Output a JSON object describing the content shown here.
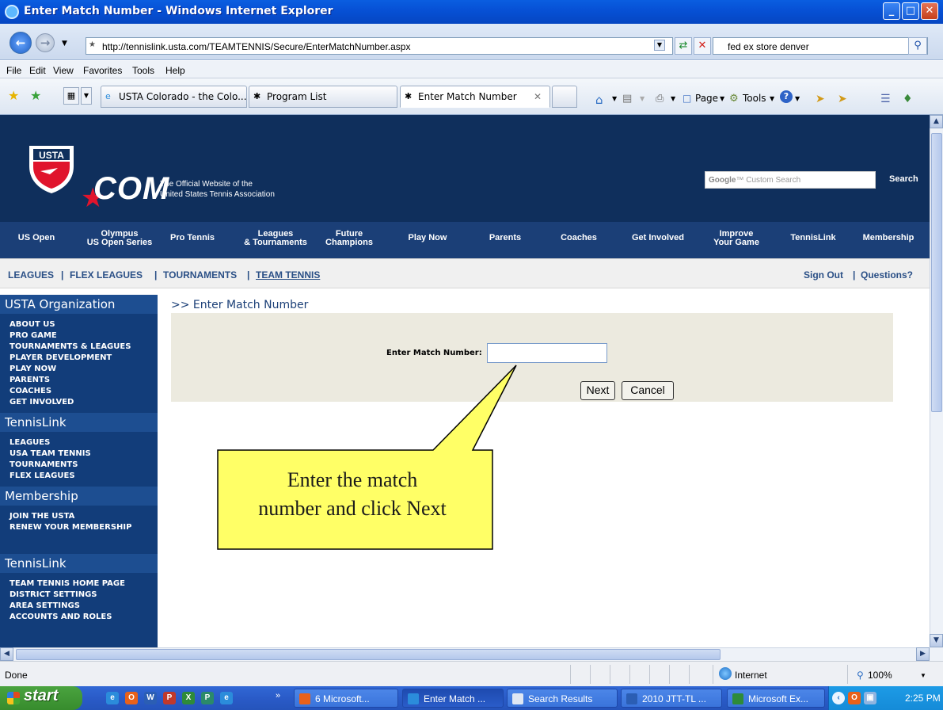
{
  "window": {
    "title": "Enter Match Number - Windows Internet Explorer"
  },
  "address": {
    "url": "http://tennislink.usta.com/TEAMTENNIS/Secure/EnterMatchNumber.aspx",
    "search_text": "fed ex store denver"
  },
  "menu": [
    "File",
    "Edit",
    "View",
    "Favorites",
    "Tools",
    "Help"
  ],
  "tabs": [
    {
      "label": "USTA Colorado - the Colo..."
    },
    {
      "label": "Program List"
    },
    {
      "label": "Enter Match Number"
    }
  ],
  "toolbar": {
    "page_label": "Page",
    "tools_label": "Tools"
  },
  "site": {
    "logo_text": "USTA",
    "com_text": "COM",
    "tagline_1": "The Official Website of the",
    "tagline_2": "United States Tennis Association",
    "search_google": "Google",
    "search_placeholder": "Custom Search",
    "search_button": "Search"
  },
  "nav": [
    {
      "l1": "US Open",
      "l2": ""
    },
    {
      "l1": "Olympus",
      "l2": "US Open Series"
    },
    {
      "l1": "Pro Tennis",
      "l2": ""
    },
    {
      "l1": "Leagues",
      "l2": "& Tournaments"
    },
    {
      "l1": "Future",
      "l2": "Champions"
    },
    {
      "l1": "Play Now",
      "l2": ""
    },
    {
      "l1": "Parents",
      "l2": ""
    },
    {
      "l1": "Coaches",
      "l2": ""
    },
    {
      "l1": "Get Involved",
      "l2": ""
    },
    {
      "l1": "Improve",
      "l2": "Your Game"
    },
    {
      "l1": "TennisLink",
      "l2": ""
    },
    {
      "l1": "Membership",
      "l2": ""
    }
  ],
  "subnav": {
    "leagues": "LEAGUES",
    "sep": "|",
    "flex": "FLEX LEAGUES",
    "tournaments": "TOURNAMENTS",
    "team_tennis": "TEAM TENNIS",
    "sign_out": "Sign Out",
    "questions": "Questions?"
  },
  "sidebar": {
    "sections": [
      {
        "title": "USTA Organization",
        "items": [
          "ABOUT US",
          "PRO GAME",
          "TOURNAMENTS & LEAGUES",
          "PLAYER DEVELOPMENT",
          "PLAY NOW",
          "PARENTS",
          "COACHES",
          "GET INVOLVED"
        ]
      },
      {
        "title": "TennisLink",
        "items": [
          "LEAGUES",
          "USA TEAM TENNIS",
          "TOURNAMENTS",
          "FLEX LEAGUES"
        ]
      },
      {
        "title": "Membership",
        "items": [
          "JOIN THE USTA",
          "RENEW YOUR MEMBERSHIP"
        ]
      },
      {
        "title": "TennisLink",
        "items": [
          "TEAM TENNIS HOME PAGE",
          "DISTRICT SETTINGS",
          "AREA SETTINGS",
          "ACCOUNTS AND ROLES"
        ]
      }
    ]
  },
  "content": {
    "page_title": ">> Enter Match Number",
    "match_label": "Enter Match Number:",
    "match_value": "",
    "next_button": "Next",
    "cancel_button": "Cancel"
  },
  "callout": {
    "line1": "Enter the match",
    "line2": "number and click Next",
    "fill_color": "#ffff66"
  },
  "status": {
    "text": "Done",
    "zone": "Internet",
    "zoom": "100%"
  },
  "taskbar": {
    "start": "start",
    "buttons": [
      {
        "label": "6 Microsoft..."
      },
      {
        "label": "Enter Match ..."
      },
      {
        "label": "Search Results"
      },
      {
        "label": "2010 JTT-TL ..."
      },
      {
        "label": "Microsoft Ex..."
      }
    ],
    "clock": "2:25 PM"
  },
  "colors": {
    "header_bg": "#0f2f5c",
    "nav_bg": "#1b3f77",
    "sidebar_bg": "#123d7a",
    "form_bg": "#eceadf"
  }
}
